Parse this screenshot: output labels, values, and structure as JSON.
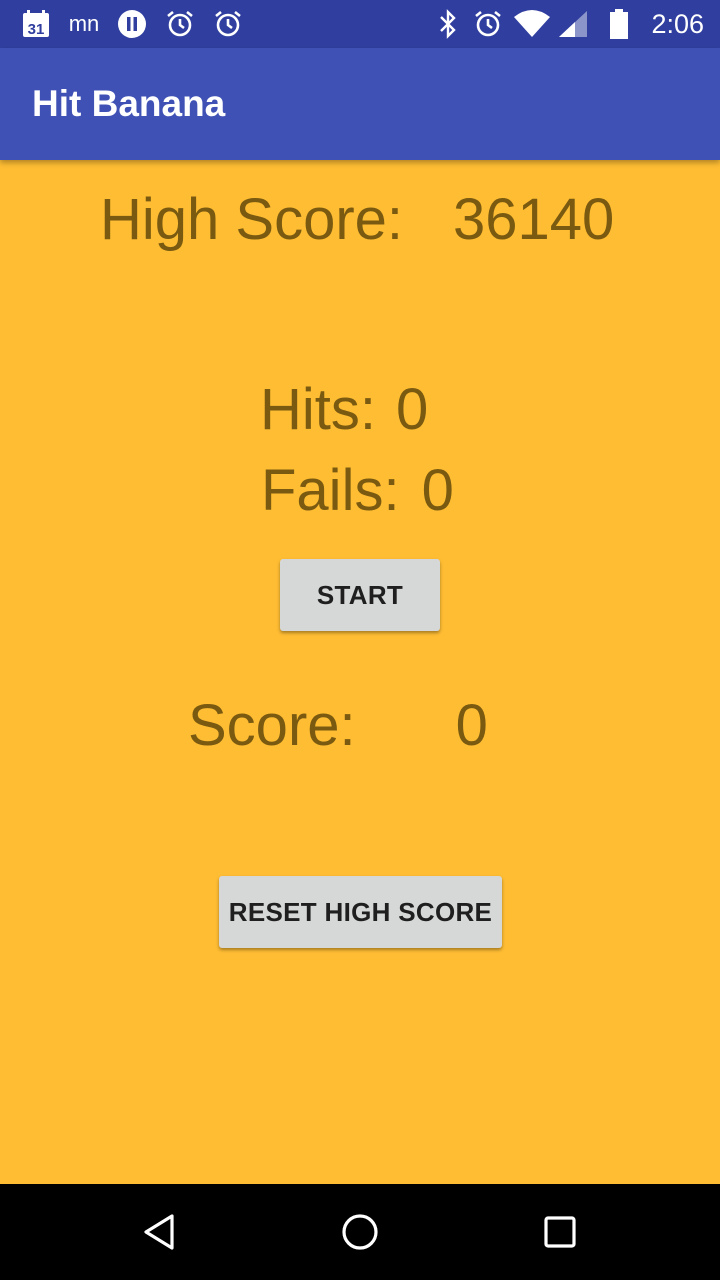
{
  "status_bar": {
    "time": "2:06",
    "left_icons": [
      "calendar-icon",
      "mn-icon",
      "pause-icon",
      "alarm-icon",
      "alarm-icon"
    ],
    "right_icons": [
      "bluetooth-icon",
      "alarm-icon",
      "wifi-icon",
      "signal-icon",
      "battery-icon"
    ],
    "calendar_day": "31",
    "mn_label": "mn"
  },
  "app_bar": {
    "title": "Hit Banana"
  },
  "game": {
    "high_score_label": "High Score:",
    "high_score_value": "36140",
    "hits_label": "Hits:",
    "hits_value": "0",
    "fails_label": "Fails:",
    "fails_value": "0",
    "start_label": "START",
    "score_label": "Score:",
    "score_value": "0",
    "reset_label": "RESET HIGH SCORE"
  },
  "colors": {
    "status_bar": "#303F9F",
    "app_bar": "#3F51B5",
    "background": "#FFBD33",
    "text": "#7A5A10",
    "button": "#D6D7D7"
  },
  "nav_bar": {
    "buttons": [
      "back-icon",
      "home-icon",
      "recents-icon"
    ]
  }
}
